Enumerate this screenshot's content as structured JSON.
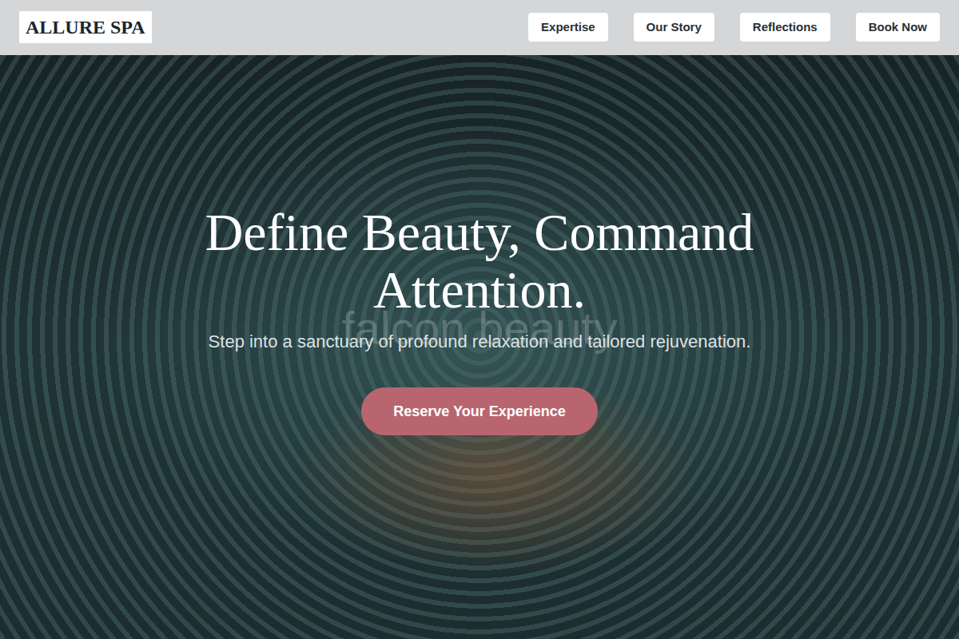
{
  "brand": "ALLURE SPA",
  "nav": [
    {
      "label": "Expertise"
    },
    {
      "label": "Our Story"
    },
    {
      "label": "Reflections"
    },
    {
      "label": "Book Now"
    }
  ],
  "hero": {
    "title": "Define Beauty, Command Attention.",
    "watermark": "falcon beauty",
    "subtitle": "Step into a sanctuary of profound relaxation and tailored rejuvenation.",
    "cta": "Reserve Your Experience"
  }
}
